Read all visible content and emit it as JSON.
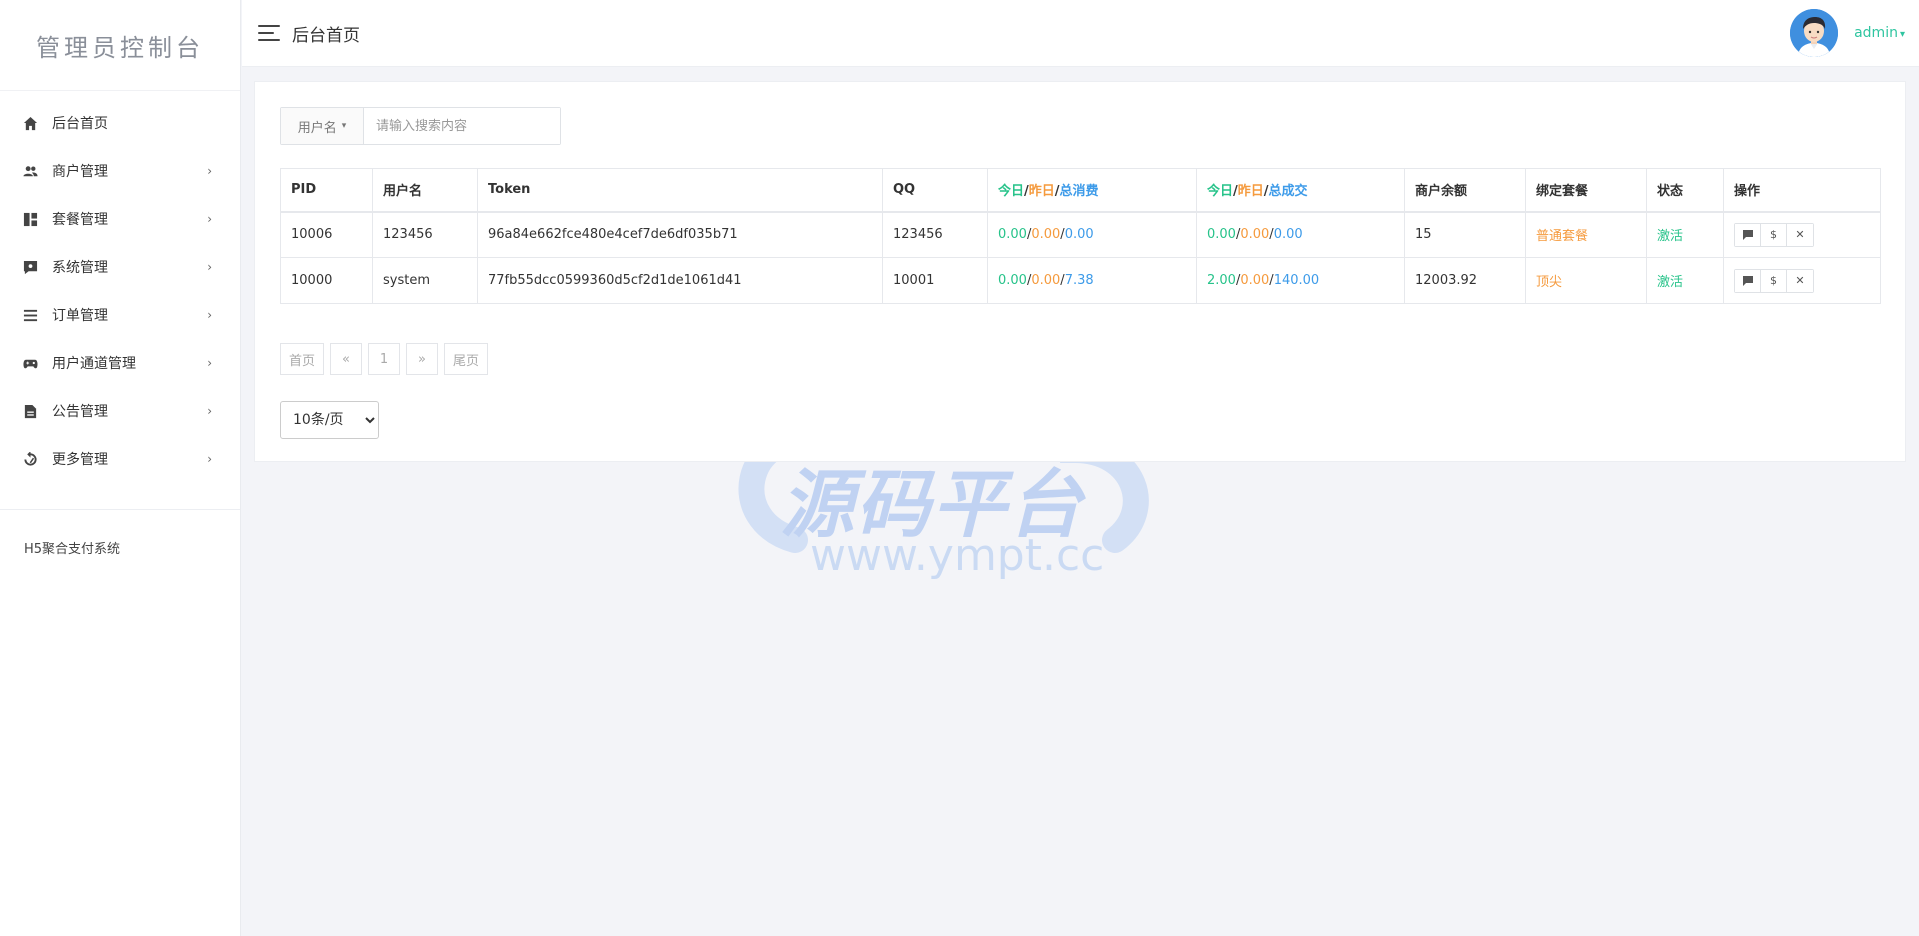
{
  "sidebar": {
    "brand": "管理员控制台",
    "items": [
      {
        "label": "后台首页",
        "icon": "home-icon",
        "has_sub": false
      },
      {
        "label": "商户管理",
        "icon": "users-icon",
        "has_sub": true
      },
      {
        "label": "套餐管理",
        "icon": "dashboard-icon",
        "has_sub": true
      },
      {
        "label": "系统管理",
        "icon": "system-icon",
        "has_sub": true
      },
      {
        "label": "订单管理",
        "icon": "list-icon",
        "has_sub": true
      },
      {
        "label": "用户通道管理",
        "icon": "gamepad-icon",
        "has_sub": true
      },
      {
        "label": "公告管理",
        "icon": "document-icon",
        "has_sub": true
      },
      {
        "label": "更多管理",
        "icon": "refresh-icon",
        "has_sub": true
      }
    ],
    "footer": "H5聚合支付系统",
    "chevron": "›"
  },
  "header": {
    "title": "后台首页",
    "username": "admin",
    "caret": "▾"
  },
  "search": {
    "field_label": "用户名",
    "caret": "▾",
    "placeholder": "请输入搜索内容"
  },
  "table": {
    "columns": {
      "pid": "PID",
      "username": "用户名",
      "token": "Token",
      "qq": "QQ",
      "consume": {
        "today": "今日",
        "yesterday": "昨日",
        "total": "总消费"
      },
      "deal": {
        "today": "今日",
        "yesterday": "昨日",
        "total": "总成交"
      },
      "balance": "商户余额",
      "package": "绑定套餐",
      "status": "状态",
      "ops": "操作"
    },
    "separator": "/",
    "rows": [
      {
        "pid": "10006",
        "username": "123456",
        "token": "96a84e662fce480e4cef7de6df035b71",
        "qq": "123456",
        "consume_today": "0.00",
        "consume_yesterday": "0.00",
        "consume_total": "0.00",
        "deal_today": "0.00",
        "deal_yesterday": "0.00",
        "deal_total": "0.00",
        "balance": "15",
        "package": "普通套餐",
        "status": "激活"
      },
      {
        "pid": "10000",
        "username": "system",
        "token": "77fb55dcc0599360d5cf2d1de1061d41",
        "qq": "10001",
        "consume_today": "0.00",
        "consume_yesterday": "0.00",
        "consume_total": "7.38",
        "deal_today": "2.00",
        "deal_yesterday": "0.00",
        "deal_total": "140.00",
        "balance": "12003.92",
        "package": "顶尖",
        "status": "激活"
      }
    ],
    "op_labels": {
      "dollar": "$",
      "close": "✕"
    }
  },
  "pagination": {
    "first": "首页",
    "prev": "«",
    "current": "1",
    "next": "»",
    "last": "尾页"
  },
  "per_page": {
    "selected": "10条/页"
  },
  "watermark": {
    "text": "源码平台",
    "url": "www.ympt.cc"
  },
  "colors": {
    "green": "#27c38a",
    "orange": "#f59a3d",
    "blue": "#3d9be9",
    "accent": "#2fc5a0"
  }
}
